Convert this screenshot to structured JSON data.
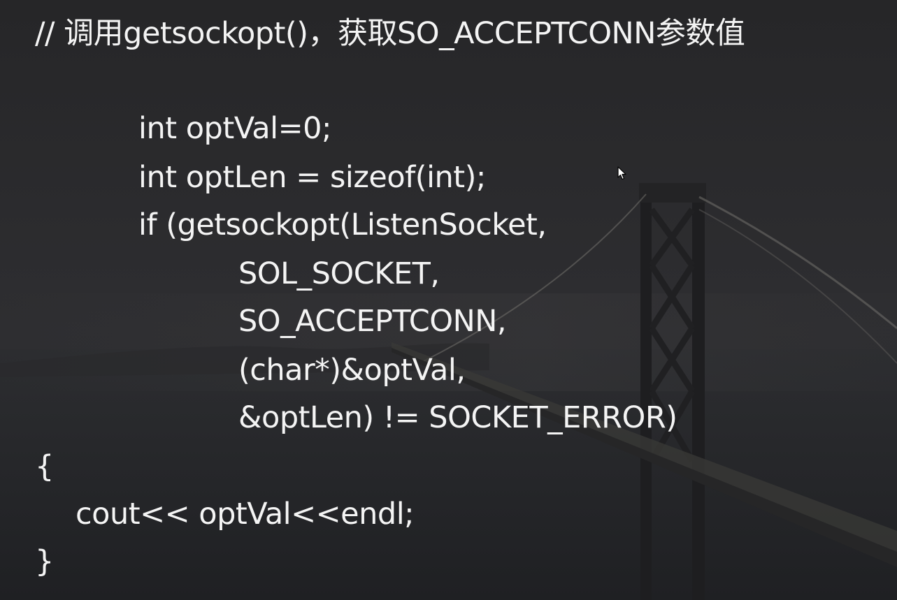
{
  "slide": {
    "comment": "// 调用getsockopt()，获取SO_ACCEPTCONN参数值",
    "code_lines": [
      "int optVal=0;",
      "int optLen = sizeof(int);",
      "if (getsockopt(ListenSocket,",
      "SOL_SOCKET,",
      "SO_ACCEPTCONN,",
      "(char*)&optVal,",
      "&optLen) != SOCKET_ERROR)",
      "{",
      "cout<< optVal<<endl;",
      "}"
    ]
  },
  "background": {
    "icon": "bridge-photo-background",
    "tint": "#2a2a2c"
  },
  "pointer": {
    "icon": "mouse-pointer-icon"
  }
}
